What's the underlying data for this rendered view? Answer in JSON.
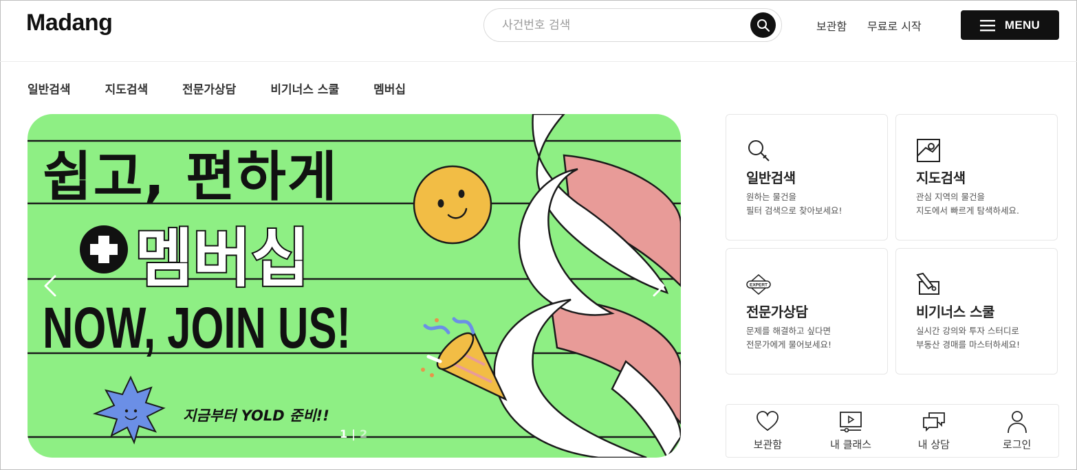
{
  "header": {
    "logo": "Madang",
    "search_placeholder": "사건번호 검색",
    "links": [
      "보관함",
      "무료로 시작"
    ],
    "menu_label": "MENU"
  },
  "nav": [
    "일반검색",
    "지도검색",
    "전문가상담",
    "비기너스 스쿨",
    "멤버십"
  ],
  "banner": {
    "line1": "쉽고, 편하게",
    "line2": "멤버십",
    "line3": "NOW, JOIN US!",
    "tagline": "지금부터 YOLD 준비!!",
    "pager_current": "1",
    "pager_sep": "|",
    "pager_next": "2"
  },
  "cards": [
    {
      "icon": "magnifier-icon",
      "title": "일반검색",
      "desc1": "원하는 물건을",
      "desc2": "필터 검색으로 찾아보세요!"
    },
    {
      "icon": "map-icon",
      "title": "지도검색",
      "desc1": "관심 지역의 물건을",
      "desc2": "지도에서 빠르게 탐색하세요."
    },
    {
      "icon": "expert-badge-icon",
      "title": "전문가상담",
      "desc1": "문제를 해결하고 싶다면",
      "desc2": "전문가에게 물어보세요!"
    },
    {
      "icon": "auction-hammer-icon",
      "title": "비기너스 스쿨",
      "desc1": "실시간 강의와 투자 스터디로",
      "desc2": "부동산 경매를 마스터하세요!"
    }
  ],
  "expert_badge_text": "EXPERT",
  "quickbar": [
    {
      "icon": "heart-icon",
      "label": "보관함"
    },
    {
      "icon": "video-class-icon",
      "label": "내 클래스"
    },
    {
      "icon": "chat-bubbles-icon",
      "label": "내 상담"
    },
    {
      "icon": "user-icon",
      "label": "로그인"
    }
  ],
  "colors": {
    "banner_bg": "#8eef84",
    "accent_black": "#111111",
    "ribbon_pink": "#e89b98",
    "smiley_yellow": "#f2bd45",
    "star_blue": "#6b8fe6"
  }
}
